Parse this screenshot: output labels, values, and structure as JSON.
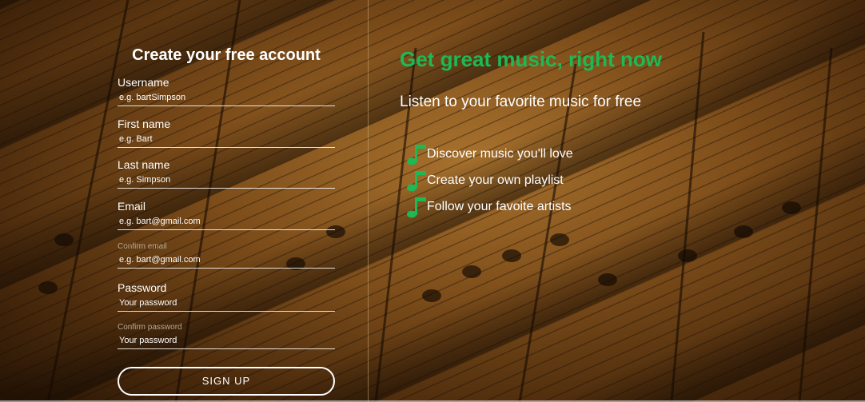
{
  "form": {
    "title": "Create your free account",
    "fields": [
      {
        "label": "Username",
        "placeholder": "e.g. bartSimpson",
        "style": "normal"
      },
      {
        "label": "First name",
        "placeholder": "e.g. Bart",
        "style": "normal"
      },
      {
        "label": "Last name",
        "placeholder": "e.g. Simpson",
        "style": "normal"
      },
      {
        "label": "Email",
        "placeholder": "e.g. bart@gmail.com",
        "style": "normal"
      },
      {
        "label": "Confirm email",
        "placeholder": "e.g. bart@gmail.com",
        "style": "small"
      },
      {
        "label": "Password",
        "placeholder": "Your password",
        "style": "normal"
      },
      {
        "label": "Confirm password",
        "placeholder": "Your password",
        "style": "small"
      }
    ],
    "signup_label": "SIGN UP"
  },
  "promo": {
    "title": "Get great music, right now",
    "subtitle": "Listen to your favorite music for free",
    "features": [
      {
        "text": "Discover music you'll love",
        "icon": "music-note-icon"
      },
      {
        "text": "Create your own playlist",
        "icon": "music-note-icon"
      },
      {
        "text": "Follow your favoite artists",
        "icon": "music-note-icon"
      }
    ]
  },
  "colors": {
    "accent": "#1db954",
    "text": "#ffffff",
    "muted_label": "#b8a993"
  }
}
